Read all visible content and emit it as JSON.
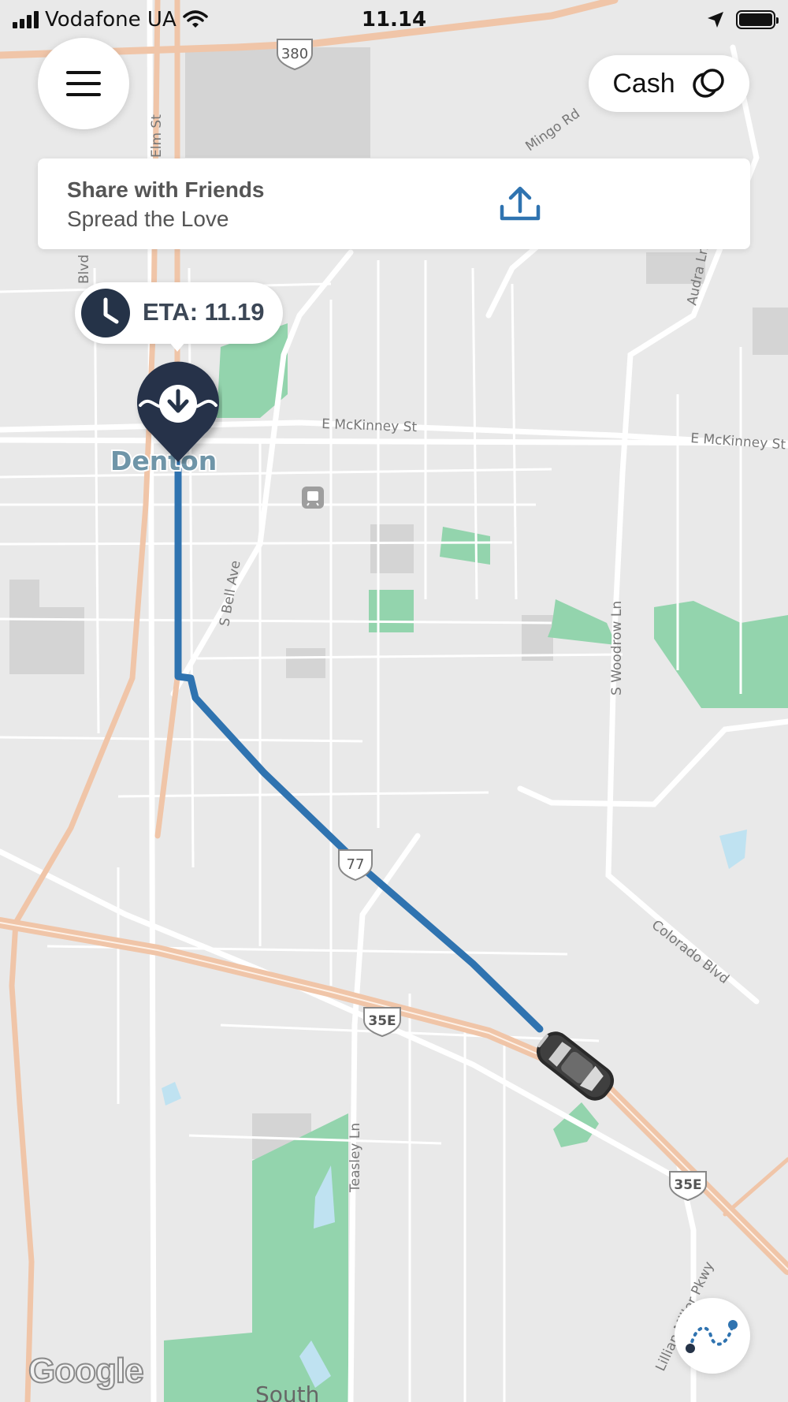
{
  "status_bar": {
    "carrier": "Vodafone UA",
    "time": "11.14"
  },
  "payment": {
    "label": "Cash",
    "icon": "payment-icon"
  },
  "share": {
    "title": "Share with Friends",
    "subtitle": "Spread the Love",
    "icon": "share-upload-icon"
  },
  "eta": {
    "label": "ETA: 11.19"
  },
  "map": {
    "city_label": "Denton",
    "area_label": "South",
    "attribution": "Google",
    "streets": {
      "elm": "Elm St",
      "mingo": "Mingo Rd",
      "audra": "Audra Ln",
      "mckinney_1": "E McKinney St",
      "mckinney_2": "E McKinney St",
      "bell": "S Bell Ave",
      "woodrow": "S Woodrow Ln",
      "colorado": "Colorado Blvd",
      "teasley": "Teasley Ln",
      "lillian": "Lillian Miller Pkwy",
      "blvd": "Blvd"
    },
    "shields": {
      "us380": "380",
      "us77": "77",
      "i35e_a": "35E",
      "i35e_b": "35E"
    },
    "colors": {
      "route": "#2f73b0",
      "park": "#93d4ad",
      "highway": "#f0c5a8",
      "pin": "#253348"
    }
  }
}
